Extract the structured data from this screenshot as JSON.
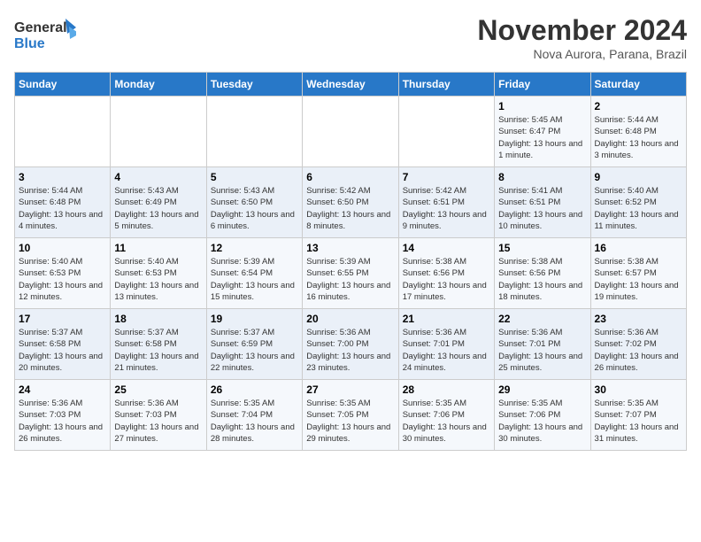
{
  "header": {
    "logo_line1": "General",
    "logo_line2": "Blue",
    "month": "November 2024",
    "location": "Nova Aurora, Parana, Brazil"
  },
  "weekdays": [
    "Sunday",
    "Monday",
    "Tuesday",
    "Wednesday",
    "Thursday",
    "Friday",
    "Saturday"
  ],
  "weeks": [
    [
      {
        "day": "",
        "info": ""
      },
      {
        "day": "",
        "info": ""
      },
      {
        "day": "",
        "info": ""
      },
      {
        "day": "",
        "info": ""
      },
      {
        "day": "",
        "info": ""
      },
      {
        "day": "1",
        "info": "Sunrise: 5:45 AM\nSunset: 6:47 PM\nDaylight: 13 hours and 1 minute."
      },
      {
        "day": "2",
        "info": "Sunrise: 5:44 AM\nSunset: 6:48 PM\nDaylight: 13 hours and 3 minutes."
      }
    ],
    [
      {
        "day": "3",
        "info": "Sunrise: 5:44 AM\nSunset: 6:48 PM\nDaylight: 13 hours and 4 minutes."
      },
      {
        "day": "4",
        "info": "Sunrise: 5:43 AM\nSunset: 6:49 PM\nDaylight: 13 hours and 5 minutes."
      },
      {
        "day": "5",
        "info": "Sunrise: 5:43 AM\nSunset: 6:50 PM\nDaylight: 13 hours and 6 minutes."
      },
      {
        "day": "6",
        "info": "Sunrise: 5:42 AM\nSunset: 6:50 PM\nDaylight: 13 hours and 8 minutes."
      },
      {
        "day": "7",
        "info": "Sunrise: 5:42 AM\nSunset: 6:51 PM\nDaylight: 13 hours and 9 minutes."
      },
      {
        "day": "8",
        "info": "Sunrise: 5:41 AM\nSunset: 6:51 PM\nDaylight: 13 hours and 10 minutes."
      },
      {
        "day": "9",
        "info": "Sunrise: 5:40 AM\nSunset: 6:52 PM\nDaylight: 13 hours and 11 minutes."
      }
    ],
    [
      {
        "day": "10",
        "info": "Sunrise: 5:40 AM\nSunset: 6:53 PM\nDaylight: 13 hours and 12 minutes."
      },
      {
        "day": "11",
        "info": "Sunrise: 5:40 AM\nSunset: 6:53 PM\nDaylight: 13 hours and 13 minutes."
      },
      {
        "day": "12",
        "info": "Sunrise: 5:39 AM\nSunset: 6:54 PM\nDaylight: 13 hours and 15 minutes."
      },
      {
        "day": "13",
        "info": "Sunrise: 5:39 AM\nSunset: 6:55 PM\nDaylight: 13 hours and 16 minutes."
      },
      {
        "day": "14",
        "info": "Sunrise: 5:38 AM\nSunset: 6:56 PM\nDaylight: 13 hours and 17 minutes."
      },
      {
        "day": "15",
        "info": "Sunrise: 5:38 AM\nSunset: 6:56 PM\nDaylight: 13 hours and 18 minutes."
      },
      {
        "day": "16",
        "info": "Sunrise: 5:38 AM\nSunset: 6:57 PM\nDaylight: 13 hours and 19 minutes."
      }
    ],
    [
      {
        "day": "17",
        "info": "Sunrise: 5:37 AM\nSunset: 6:58 PM\nDaylight: 13 hours and 20 minutes."
      },
      {
        "day": "18",
        "info": "Sunrise: 5:37 AM\nSunset: 6:58 PM\nDaylight: 13 hours and 21 minutes."
      },
      {
        "day": "19",
        "info": "Sunrise: 5:37 AM\nSunset: 6:59 PM\nDaylight: 13 hours and 22 minutes."
      },
      {
        "day": "20",
        "info": "Sunrise: 5:36 AM\nSunset: 7:00 PM\nDaylight: 13 hours and 23 minutes."
      },
      {
        "day": "21",
        "info": "Sunrise: 5:36 AM\nSunset: 7:01 PM\nDaylight: 13 hours and 24 minutes."
      },
      {
        "day": "22",
        "info": "Sunrise: 5:36 AM\nSunset: 7:01 PM\nDaylight: 13 hours and 25 minutes."
      },
      {
        "day": "23",
        "info": "Sunrise: 5:36 AM\nSunset: 7:02 PM\nDaylight: 13 hours and 26 minutes."
      }
    ],
    [
      {
        "day": "24",
        "info": "Sunrise: 5:36 AM\nSunset: 7:03 PM\nDaylight: 13 hours and 26 minutes."
      },
      {
        "day": "25",
        "info": "Sunrise: 5:36 AM\nSunset: 7:03 PM\nDaylight: 13 hours and 27 minutes."
      },
      {
        "day": "26",
        "info": "Sunrise: 5:35 AM\nSunset: 7:04 PM\nDaylight: 13 hours and 28 minutes."
      },
      {
        "day": "27",
        "info": "Sunrise: 5:35 AM\nSunset: 7:05 PM\nDaylight: 13 hours and 29 minutes."
      },
      {
        "day": "28",
        "info": "Sunrise: 5:35 AM\nSunset: 7:06 PM\nDaylight: 13 hours and 30 minutes."
      },
      {
        "day": "29",
        "info": "Sunrise: 5:35 AM\nSunset: 7:06 PM\nDaylight: 13 hours and 30 minutes."
      },
      {
        "day": "30",
        "info": "Sunrise: 5:35 AM\nSunset: 7:07 PM\nDaylight: 13 hours and 31 minutes."
      }
    ]
  ]
}
